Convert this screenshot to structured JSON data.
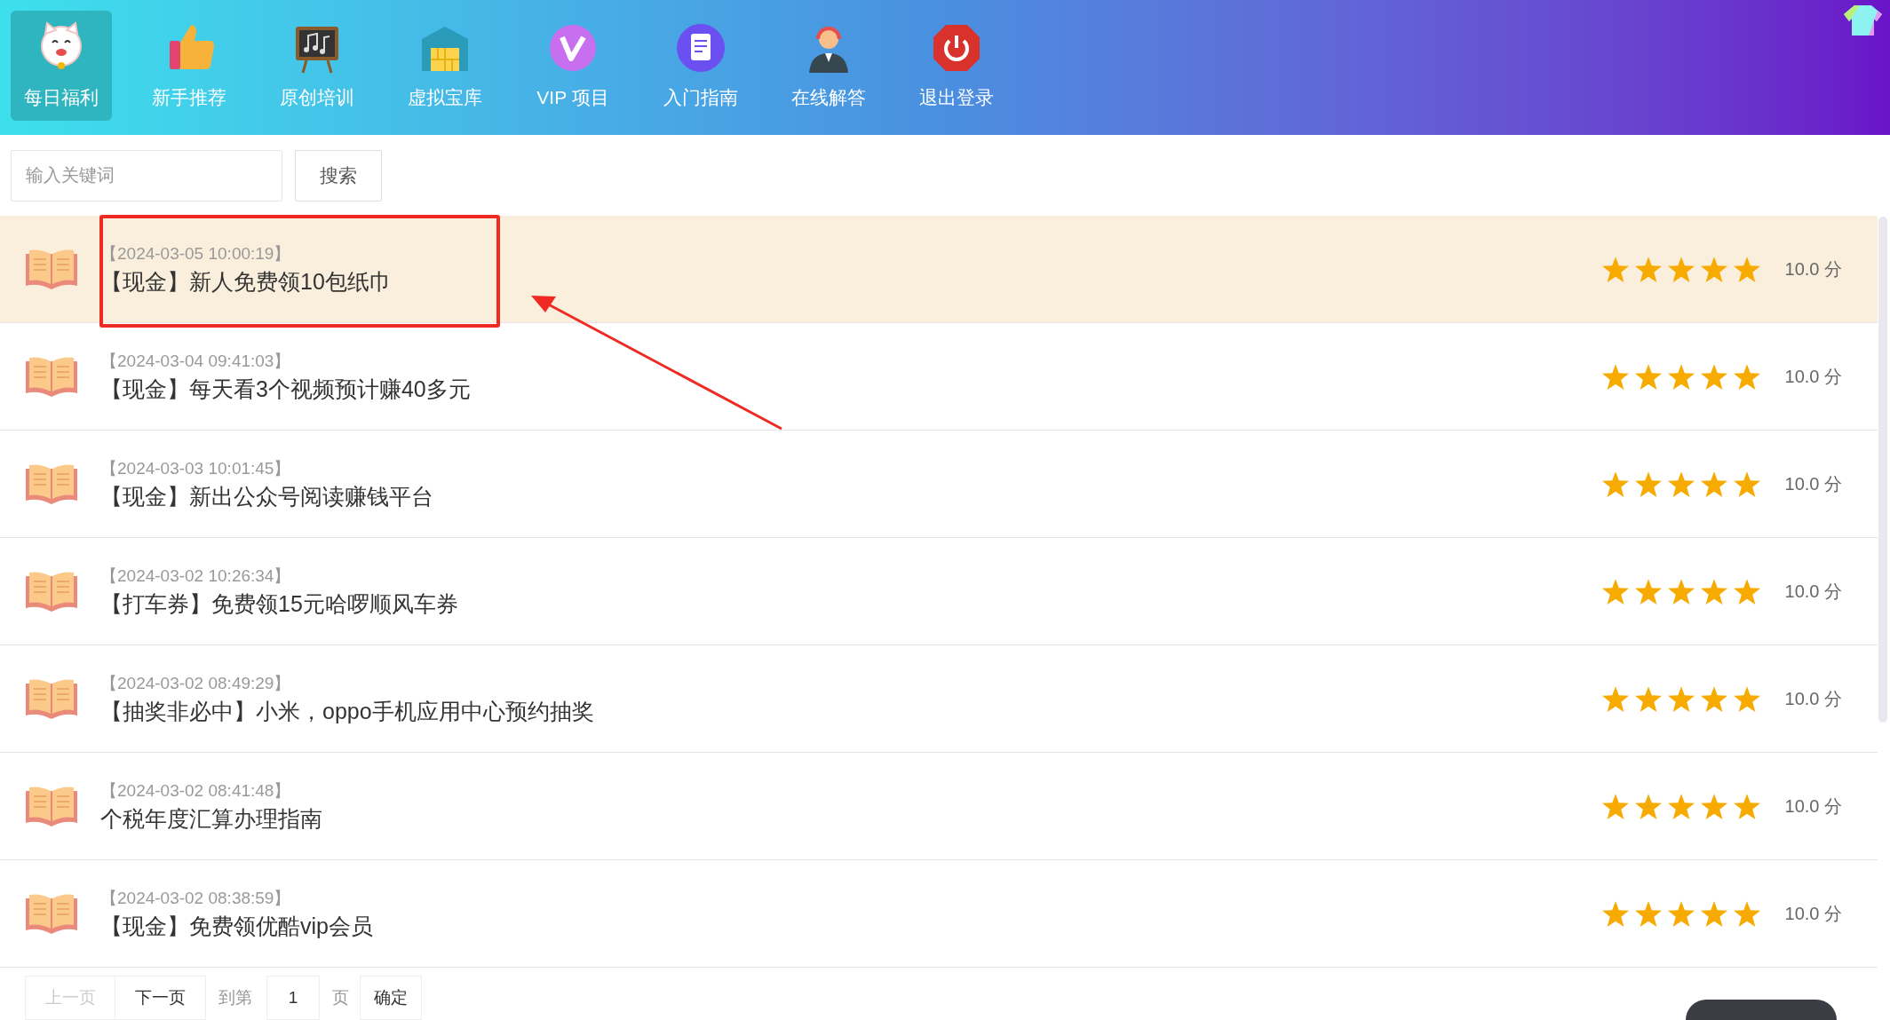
{
  "nav": [
    {
      "label": "每日福利",
      "selected": true
    },
    {
      "label": "新手推荐",
      "selected": false
    },
    {
      "label": "原创培训",
      "selected": false
    },
    {
      "label": "虚拟宝库",
      "selected": false
    },
    {
      "label": "VIP 项目",
      "selected": false
    },
    {
      "label": "入门指南",
      "selected": false
    },
    {
      "label": "在线解答",
      "selected": false
    },
    {
      "label": "退出登录",
      "selected": false
    }
  ],
  "search": {
    "placeholder": "输入关键词",
    "button": "搜索"
  },
  "articles": [
    {
      "date": "【2024-03-05 10:00:19】",
      "title": "【现金】新人免费领10包纸巾",
      "stars": 5,
      "score": "10.0 分",
      "selected": true
    },
    {
      "date": "【2024-03-04 09:41:03】",
      "title": "【现金】每天看3个视频预计赚40多元",
      "stars": 5,
      "score": "10.0 分",
      "selected": false
    },
    {
      "date": "【2024-03-03 10:01:45】",
      "title": "【现金】新出公众号阅读赚钱平台",
      "stars": 5,
      "score": "10.0 分",
      "selected": false
    },
    {
      "date": "【2024-03-02 10:26:34】",
      "title": "【打车券】免费领15元哈啰顺风车券",
      "stars": 5,
      "score": "10.0 分",
      "selected": false
    },
    {
      "date": "【2024-03-02 08:49:29】",
      "title": "【抽奖非必中】小米，oppo手机应用中心预约抽奖",
      "stars": 5,
      "score": "10.0 分",
      "selected": false
    },
    {
      "date": "【2024-03-02 08:41:48】",
      "title": "个税年度汇算办理指南",
      "stars": 5,
      "score": "10.0 分",
      "selected": false
    },
    {
      "date": "【2024-03-02 08:38:59】",
      "title": "【现金】免费领优酷vip会员",
      "stars": 5,
      "score": "10.0 分",
      "selected": false
    }
  ],
  "pagination": {
    "prev": {
      "label": "上一页",
      "disabled": true
    },
    "next": {
      "label": "下一页",
      "disabled": false
    },
    "goto_label": "到第",
    "page": "1",
    "page_label": "页",
    "confirm": "确定"
  }
}
